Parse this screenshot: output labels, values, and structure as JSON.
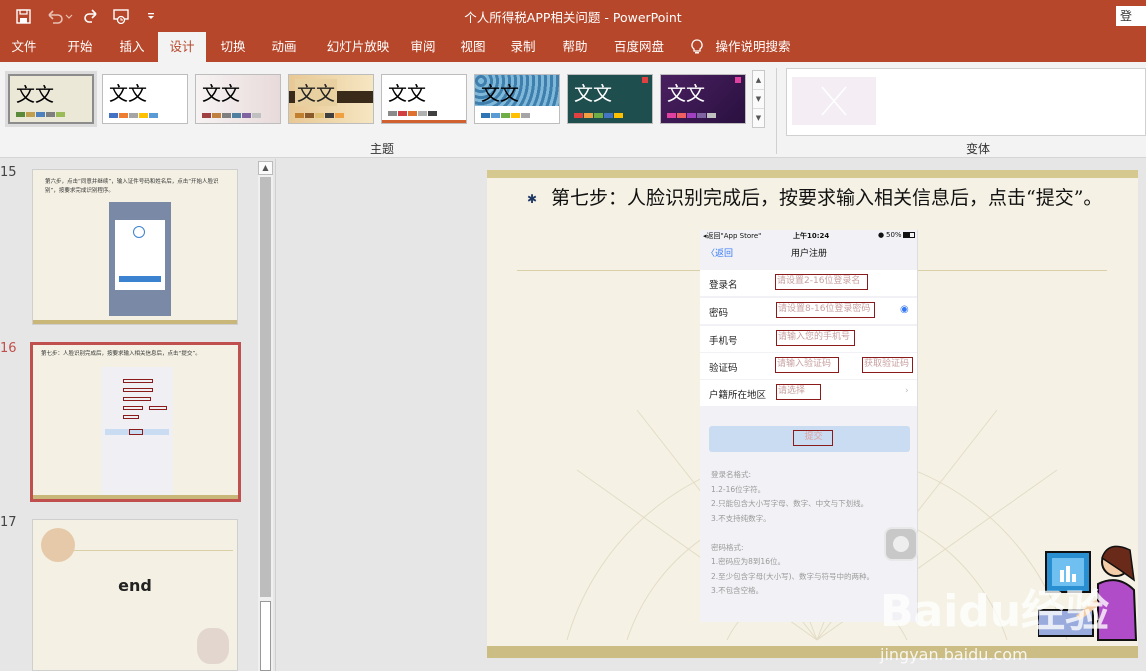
{
  "title": {
    "doc": "个人所得税APP相关问题",
    "app": "PowerPoint",
    "login": "登"
  },
  "qa_icons": [
    "save-icon",
    "undo-icon",
    "redo-icon",
    "present-icon",
    "customize-icon"
  ],
  "tabs": [
    "文件",
    "开始",
    "插入",
    "设计",
    "切换",
    "动画",
    "幻灯片放映",
    "审阅",
    "视图",
    "录制",
    "帮助",
    "百度网盘",
    "操作说明搜索"
  ],
  "active_tab": "设计",
  "ribbon": {
    "theme_group": "主题",
    "variant_group": "变体",
    "theme_text": "文文",
    "themes": [
      {
        "colors": [
          "#5b8a3a",
          "#c0a050",
          "#4f81bd",
          "#7f7f7f",
          "#9bbb59"
        ]
      },
      {
        "colors": [
          "#4472c4",
          "#ed7d31",
          "#a5a5a5",
          "#ffc000",
          "#5b9bd5"
        ]
      },
      {
        "colors": [
          "#a04040",
          "#c08040",
          "#7f7f7f",
          "#5080a0",
          "#8064a2"
        ]
      },
      {
        "colors": [
          "#c08030",
          "#8a5a2a",
          "#e0c070",
          "#3f3f3f",
          "#f0a040"
        ]
      },
      {
        "colors": [
          "#8a8a8a",
          "#d04040",
          "#e07030",
          "#b0b0b0",
          "#404040"
        ]
      },
      {
        "colors": [
          "#2e75b6",
          "#5b9bd5",
          "#70ad47",
          "#ffc000",
          "#a5a5a5"
        ]
      },
      {
        "colors": [
          "#e04040",
          "#f0a040",
          "#70ad47",
          "#4472c4",
          "#ffc000"
        ]
      },
      {
        "colors": [
          "#e040a0",
          "#f06060",
          "#a040c0",
          "#8064a2",
          "#c0c0c0"
        ]
      }
    ]
  },
  "thumbs": [
    {
      "num": "15",
      "text": "第六步，点击“同意并继续”，输入证件号码和姓名后，点击“开始人脸识别”，按要求完成识别程序。"
    },
    {
      "num": "16",
      "text": "第七步：人脸识别完成后，按要求输入相关信息后，点击“提交”。"
    },
    {
      "num": "17",
      "text": "end"
    }
  ],
  "slide": {
    "step_text": "第七步：人脸识别完成后，按要求输入相关信息后，点击“提交”。",
    "phone": {
      "status_left": "◂返回\"App Store\"",
      "status_time": "上午10:24",
      "status_right": "50%",
      "back": "〈返回",
      "nav_title": "用户注册",
      "fields": [
        {
          "label": "登录名",
          "placeholder": "请设置2-16位登录名"
        },
        {
          "label": "密码",
          "placeholder": "请设置8-16位登录密码"
        },
        {
          "label": "手机号",
          "placeholder": "请输入您的手机号"
        },
        {
          "label": "验证码",
          "placeholder": "请输入验证码",
          "extra": "获取验证码"
        },
        {
          "label": "户籍所在地区",
          "placeholder": "请选择"
        }
      ],
      "submit": "提交",
      "rules": [
        "登录名格式:",
        "1.2-16位字符。",
        "2.只能包含大小写字母、数字、中文与下划线。",
        "3.不支持纯数字。",
        "",
        "密码格式:",
        "1.密码应为8到16位。",
        "2.至少包含字母(大小写)、数字与符号中的两种。",
        "3.不包含空格。"
      ]
    }
  },
  "watermark": {
    "brand": "Baidu经验",
    "url": "jingyan.baidu.com"
  }
}
